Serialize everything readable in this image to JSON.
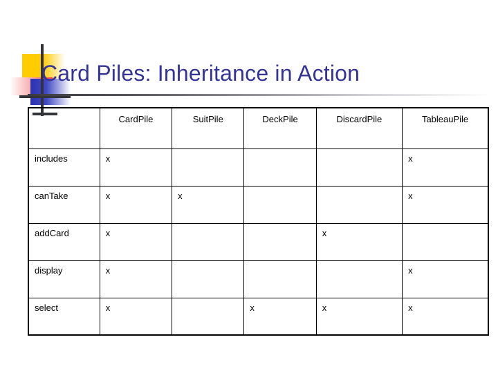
{
  "slide": {
    "title": "Card Piles: Inheritance in Action"
  },
  "decoration": {
    "name": "slide-accent-graphic",
    "colors": {
      "yellow": "#ffcc00",
      "red": "#ef3b3b",
      "blue": "#2b32b2",
      "line": "#33333a"
    }
  },
  "theme": {
    "title_color": "#333399",
    "rule_color": "#3a3a3f",
    "table_border": "#000000",
    "background": "#ffffff"
  },
  "table": {
    "corner_label": "",
    "columns": [
      "CardPile",
      "SuitPile",
      "DeckPile",
      "DiscardPile",
      "TableauPile"
    ],
    "mark": "x",
    "rows": [
      {
        "label": "includes",
        "cells": [
          "x",
          "",
          "",
          "",
          "x"
        ]
      },
      {
        "label": "canTake",
        "cells": [
          "x",
          "x",
          "",
          "",
          "x"
        ]
      },
      {
        "label": "addCard",
        "cells": [
          "x",
          "",
          "",
          "x",
          ""
        ]
      },
      {
        "label": "display",
        "cells": [
          "x",
          "",
          "",
          "",
          "x"
        ]
      },
      {
        "label": "select",
        "cells": [
          "x",
          "",
          "x",
          "x",
          "x"
        ]
      }
    ]
  }
}
